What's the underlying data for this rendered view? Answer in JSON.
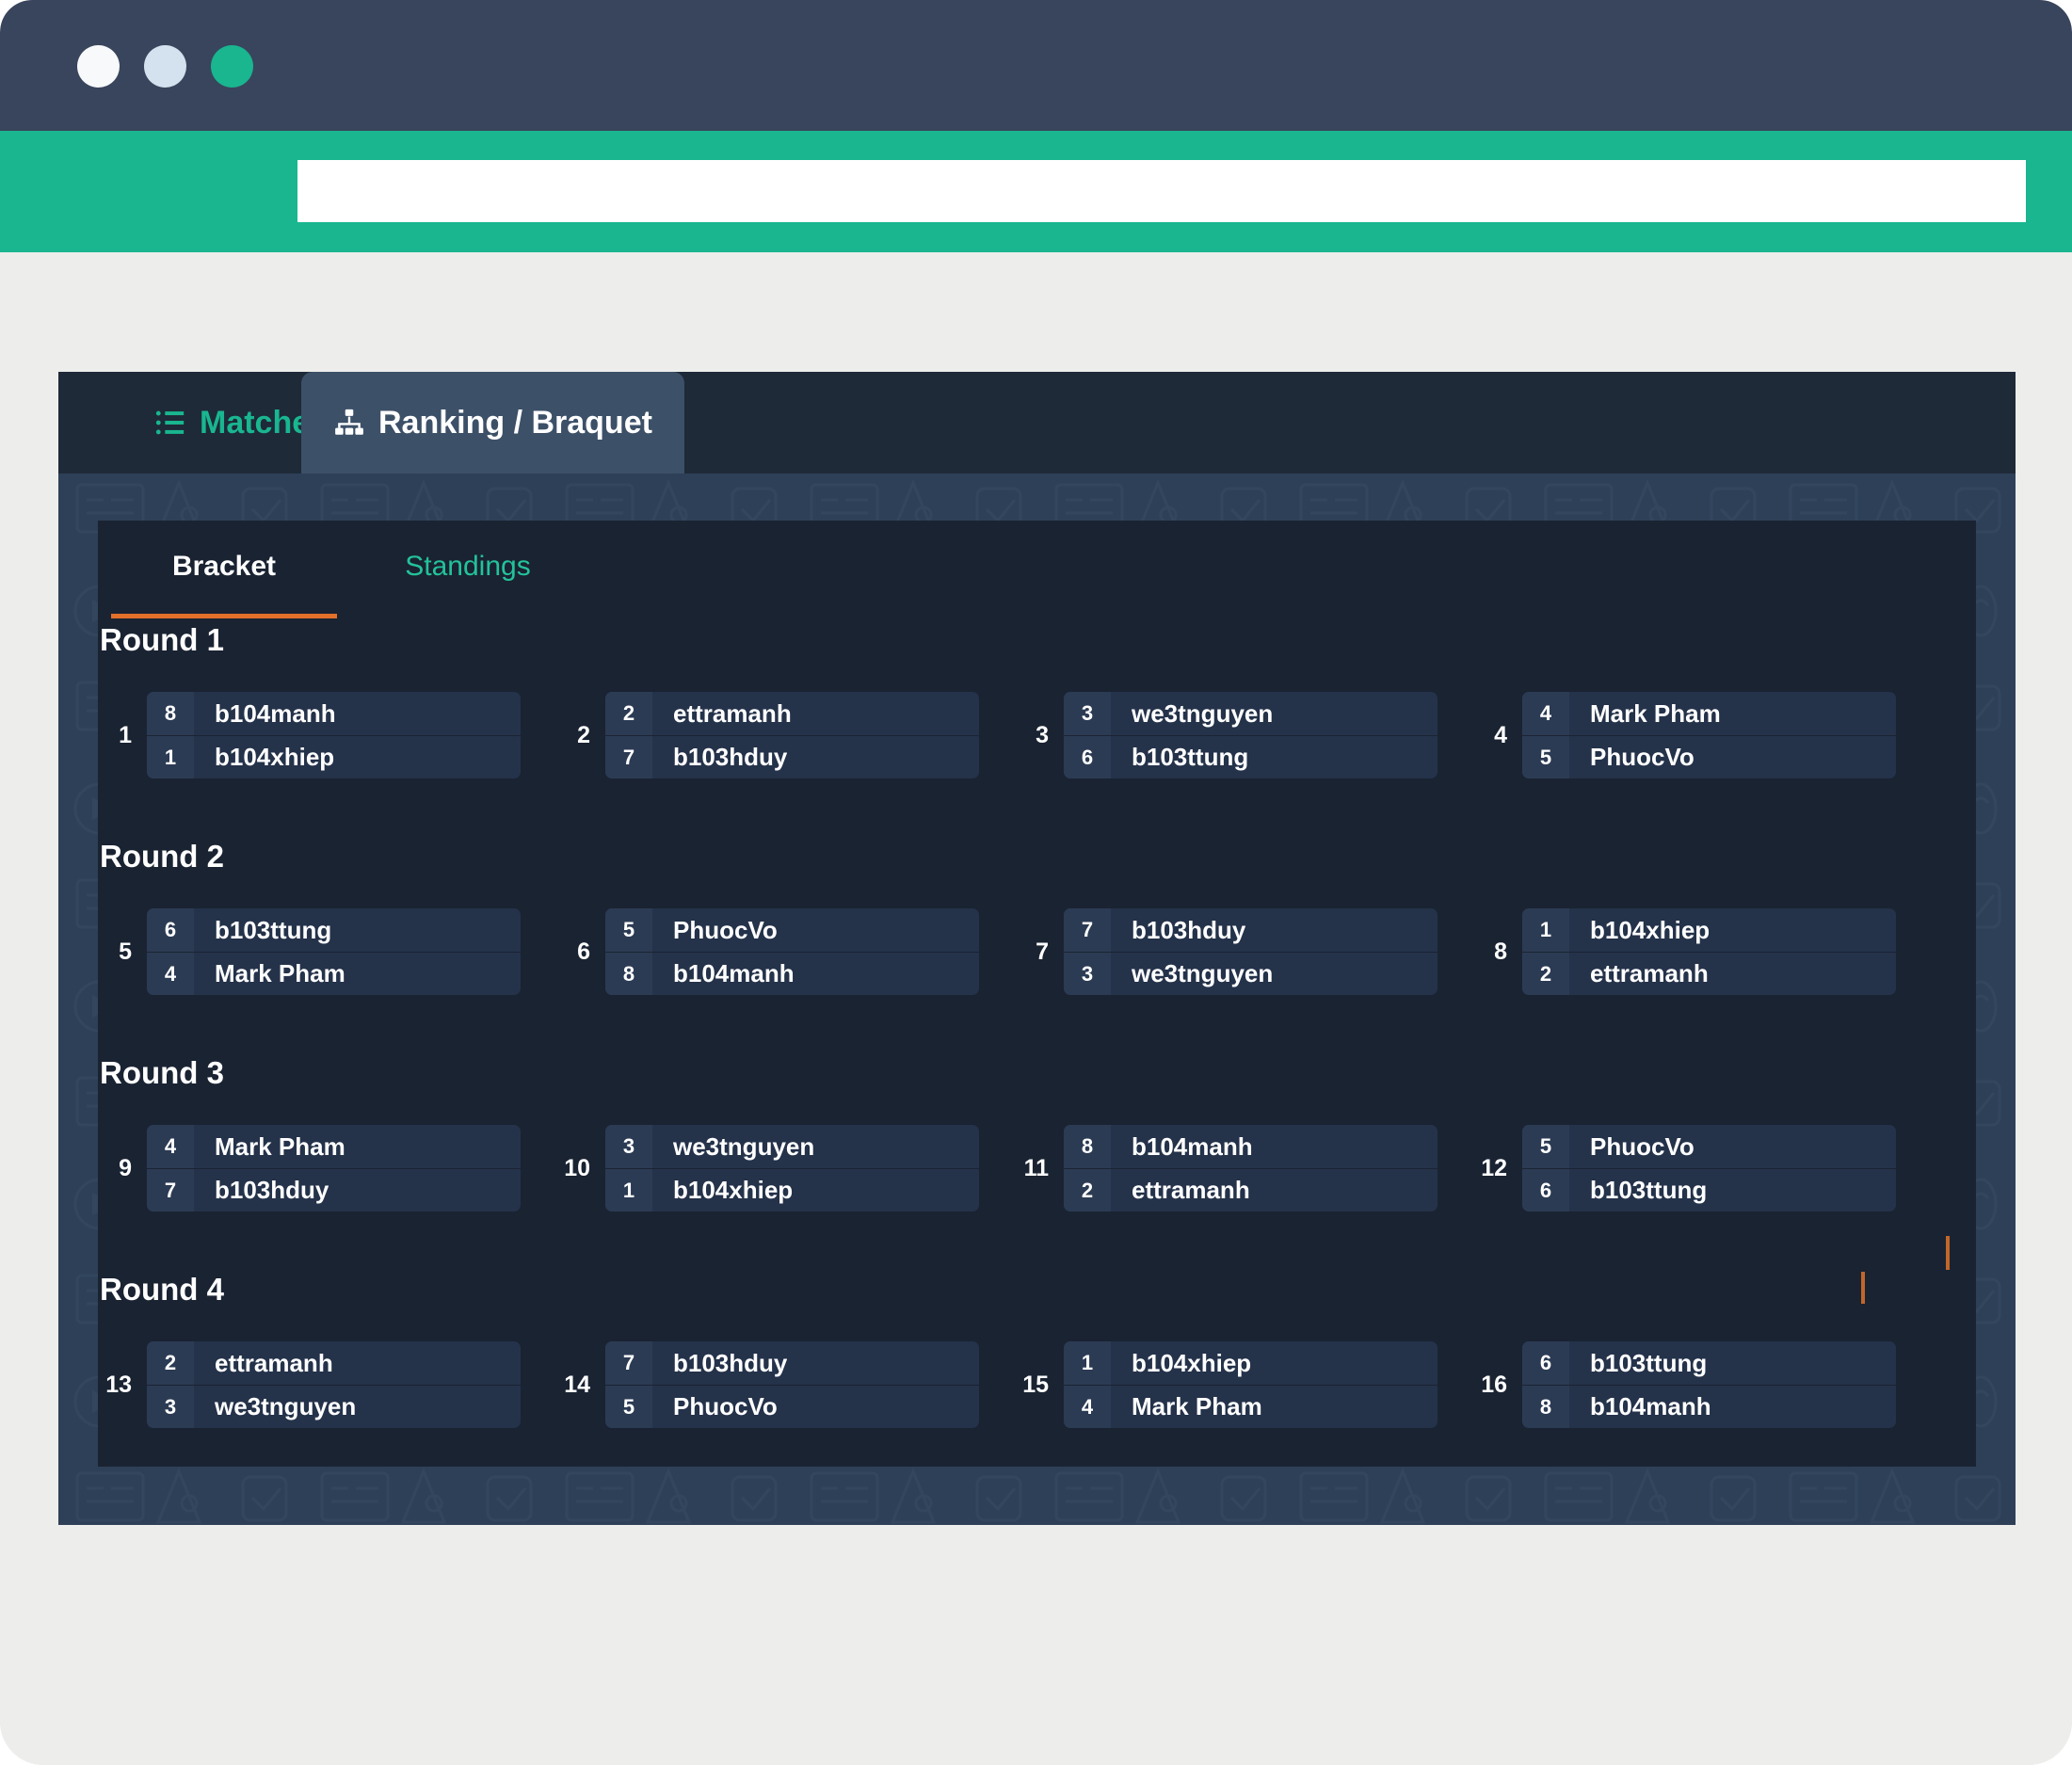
{
  "browser": {
    "dots": [
      "window-dot-white",
      "window-dot-blue",
      "window-dot-green"
    ],
    "address_value": "",
    "address_placeholder": ""
  },
  "colors": {
    "accent_green": "#19b690",
    "accent_orange": "#e1702a",
    "titlebar": "#39455c",
    "app_bg": "#2e4057",
    "panel_bg": "#1a2332",
    "card_bg": "#24324a",
    "seed_bg": "#2c3b54"
  },
  "tabs": [
    {
      "label": "Matches",
      "icon": "list-icon",
      "active": false
    },
    {
      "label": "Ranking / Braquet",
      "icon": "sitemap-icon",
      "active": true
    }
  ],
  "subtabs": [
    {
      "label": "Bracket",
      "active": true
    },
    {
      "label": "Standings",
      "active": false
    }
  ],
  "rounds": [
    {
      "title": "Round 1",
      "matches": [
        {
          "number": "1",
          "slots": [
            {
              "seed": "8",
              "name": "b104manh"
            },
            {
              "seed": "1",
              "name": "b104xhiep"
            }
          ]
        },
        {
          "number": "2",
          "slots": [
            {
              "seed": "2",
              "name": "ettramanh"
            },
            {
              "seed": "7",
              "name": "b103hduy"
            }
          ]
        },
        {
          "number": "3",
          "slots": [
            {
              "seed": "3",
              "name": "we3tnguyen"
            },
            {
              "seed": "6",
              "name": "b103ttung"
            }
          ]
        },
        {
          "number": "4",
          "slots": [
            {
              "seed": "4",
              "name": "Mark Pham"
            },
            {
              "seed": "5",
              "name": "PhuocVo"
            }
          ]
        }
      ]
    },
    {
      "title": "Round 2",
      "matches": [
        {
          "number": "5",
          "slots": [
            {
              "seed": "6",
              "name": "b103ttung"
            },
            {
              "seed": "4",
              "name": "Mark Pham"
            }
          ]
        },
        {
          "number": "6",
          "slots": [
            {
              "seed": "5",
              "name": "PhuocVo"
            },
            {
              "seed": "8",
              "name": "b104manh"
            }
          ]
        },
        {
          "number": "7",
          "slots": [
            {
              "seed": "7",
              "name": "b103hduy"
            },
            {
              "seed": "3",
              "name": "we3tnguyen"
            }
          ]
        },
        {
          "number": "8",
          "slots": [
            {
              "seed": "1",
              "name": "b104xhiep"
            },
            {
              "seed": "2",
              "name": "ettramanh"
            }
          ]
        }
      ]
    },
    {
      "title": "Round 3",
      "matches": [
        {
          "number": "9",
          "slots": [
            {
              "seed": "4",
              "name": "Mark Pham"
            },
            {
              "seed": "7",
              "name": "b103hduy"
            }
          ]
        },
        {
          "number": "10",
          "slots": [
            {
              "seed": "3",
              "name": "we3tnguyen"
            },
            {
              "seed": "1",
              "name": "b104xhiep"
            }
          ]
        },
        {
          "number": "11",
          "slots": [
            {
              "seed": "8",
              "name": "b104manh"
            },
            {
              "seed": "2",
              "name": "ettramanh"
            }
          ]
        },
        {
          "number": "12",
          "slots": [
            {
              "seed": "5",
              "name": "PhuocVo"
            },
            {
              "seed": "6",
              "name": "b103ttung"
            }
          ]
        }
      ]
    },
    {
      "title": "Round 4",
      "matches": [
        {
          "number": "13",
          "slots": [
            {
              "seed": "2",
              "name": "ettramanh"
            },
            {
              "seed": "3",
              "name": "we3tnguyen"
            }
          ]
        },
        {
          "number": "14",
          "slots": [
            {
              "seed": "7",
              "name": "b103hduy"
            },
            {
              "seed": "5",
              "name": "PhuocVo"
            }
          ]
        },
        {
          "number": "15",
          "slots": [
            {
              "seed": "1",
              "name": "b104xhiep"
            },
            {
              "seed": "4",
              "name": "Mark Pham"
            }
          ]
        },
        {
          "number": "16",
          "slots": [
            {
              "seed": "6",
              "name": "b103ttung"
            },
            {
              "seed": "8",
              "name": "b104manh"
            }
          ]
        }
      ]
    }
  ]
}
